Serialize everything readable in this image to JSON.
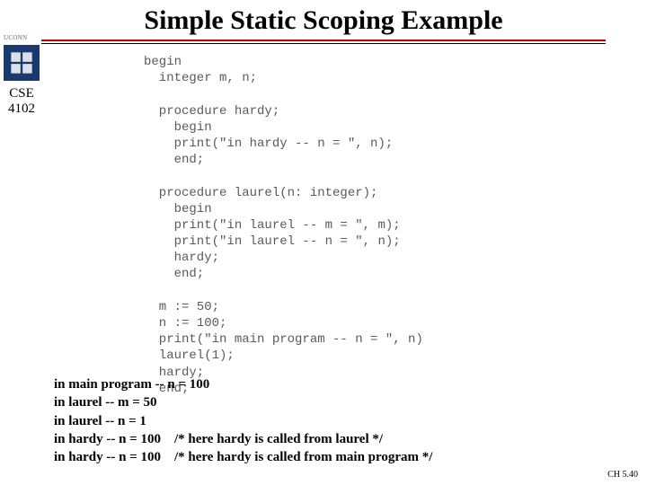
{
  "header": {
    "title": "Simple Static Scoping Example"
  },
  "logo": {
    "uconn": "UCONN",
    "course_line1": "CSE",
    "course_line2": "4102"
  },
  "code": "begin\n  integer m, n;\n\n  procedure hardy;\n    begin\n    print(\"in hardy -- n = \", n);\n    end;\n\n  procedure laurel(n: integer);\n    begin\n    print(\"in laurel -- m = \", m);\n    print(\"in laurel -- n = \", n);\n    hardy;\n    end;\n\n  m := 50;\n  n := 100;\n  print(\"in main program -- n = \", n)\n  laurel(1);\n  hardy;\n  end;",
  "output": {
    "line1": "in main program -- n = 100",
    "line2": "in laurel -- m = 50",
    "line3": "in laurel -- n = 1",
    "line4": "in hardy -- n = 100    /* here hardy is called from laurel */",
    "line5": "in hardy -- n = 100    /* here hardy is called from main program */"
  },
  "footer": {
    "chapter": "CH 5.40"
  }
}
